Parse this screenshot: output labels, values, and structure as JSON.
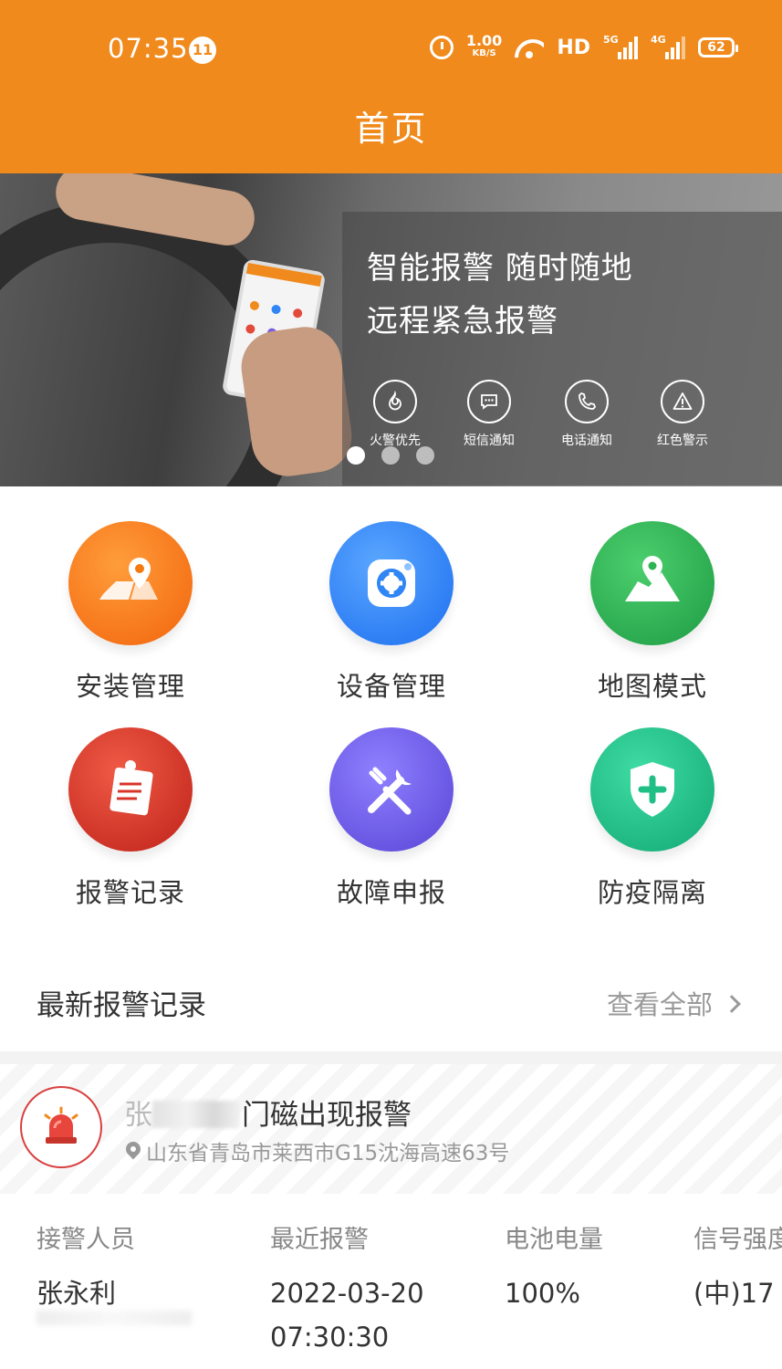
{
  "status_bar": {
    "time": "07:35",
    "notification_count": "11",
    "net_speed": "1.00",
    "net_speed_unit": "KB/S",
    "hd_label": "HD",
    "sim1_type": "5G",
    "sim2_type": "4G",
    "battery_level": "62"
  },
  "header": {
    "title": "首页"
  },
  "banner": {
    "slogan_line1": "智能报警  随时随地",
    "slogan_line2": "远程紧急报警",
    "features": [
      {
        "label": "火警优先",
        "icon": "flame-icon"
      },
      {
        "label": "短信通知",
        "icon": "message-icon"
      },
      {
        "label": "电话通知",
        "icon": "phone-icon"
      },
      {
        "label": "红色警示",
        "icon": "warning-icon"
      }
    ],
    "active_slide": 1,
    "slide_count": 3
  },
  "menu": [
    {
      "label": "安装管理",
      "icon": "map-pin-install-icon",
      "color": "#f47a12"
    },
    {
      "label": "设备管理",
      "icon": "device-icon",
      "color": "#2f86f4"
    },
    {
      "label": "地图模式",
      "icon": "map-icon",
      "color": "#2eb455"
    },
    {
      "label": "报警记录",
      "icon": "alarm-record-icon",
      "color": "#d8342a"
    },
    {
      "label": "故障申报",
      "icon": "tools-icon",
      "color": "#6b5be6"
    },
    {
      "label": "防疫隔离",
      "icon": "shield-plus-icon",
      "color": "#1fbf86"
    }
  ],
  "alarm_section": {
    "title": "最新报警记录",
    "view_all": "查看全部"
  },
  "latest_alarm": {
    "title_prefix": "张",
    "title_suffix": "门磁出现报警",
    "address": "山东省青岛市莱西市G15沈海高速63号",
    "fields": [
      {
        "key": "接警人员",
        "value": "张永利"
      },
      {
        "key": "最近报警",
        "value": "2022-03-20 07:30:30"
      },
      {
        "key": "电池电量",
        "value": "100%"
      },
      {
        "key": "信号强度",
        "value": "(中)17"
      }
    ]
  }
}
